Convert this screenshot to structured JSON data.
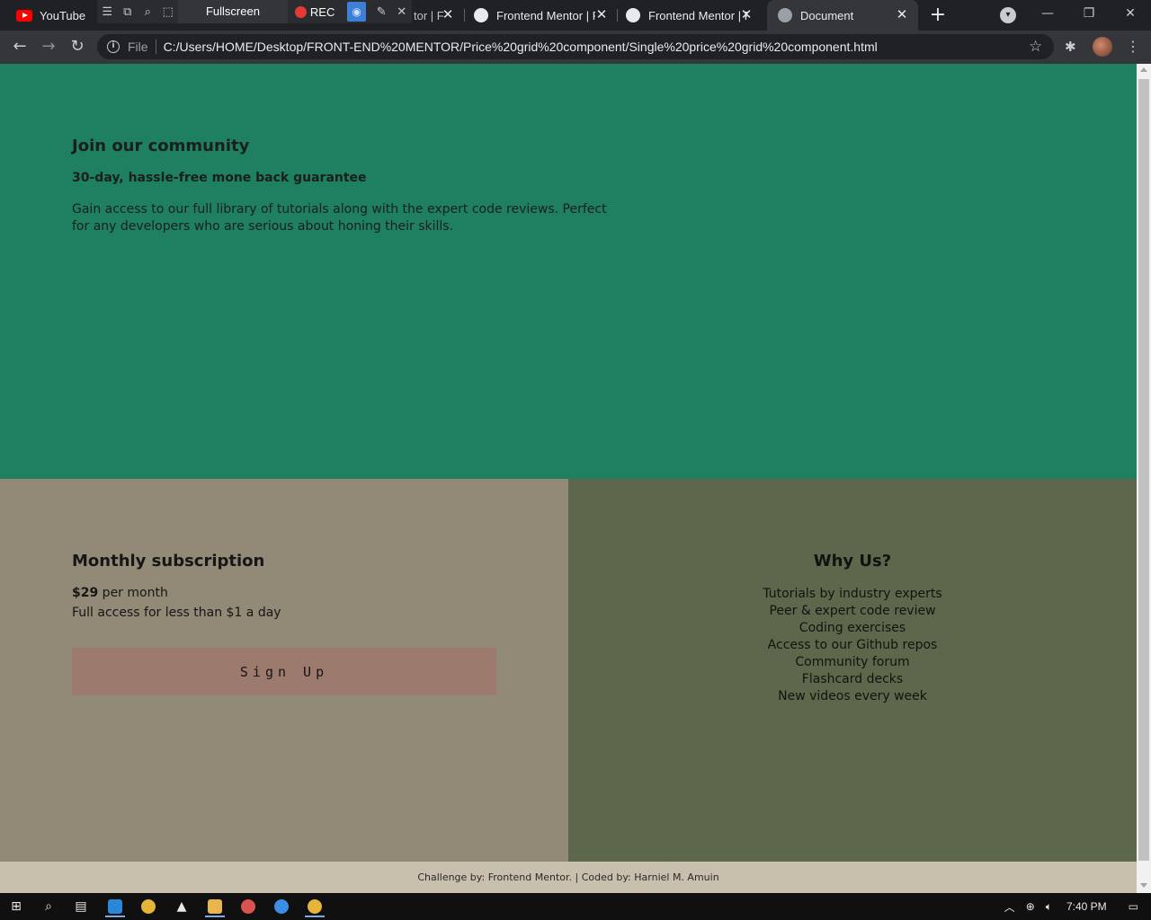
{
  "browser": {
    "tabs": [
      {
        "title": "YouTube"
      },
      {
        "title": "tor | F"
      },
      {
        "title": "Frontend Mentor | F"
      },
      {
        "title": "Frontend Mentor | F"
      },
      {
        "title": "Document"
      }
    ],
    "recorder": {
      "fullscreen_label": "Fullscreen",
      "rec_label": "REC"
    },
    "address": {
      "scheme_label": "File",
      "url": "C:/Users/HOME/Desktop/FRONT-END%20MENTOR/Price%20grid%20component/Single%20price%20grid%20component.html"
    }
  },
  "page": {
    "community": {
      "title": "Join our community",
      "subtitle": "30-day, hassle-free mone back guarantee",
      "description": "Gain access to our full library of tutorials along with the expert code reviews. Perfect for any developers who are serious about honing their skills."
    },
    "subscription": {
      "title": "Monthly subscription",
      "price": "$29",
      "period": " per month",
      "access": "Full access for less than $1 a day",
      "button": "Sign Up"
    },
    "why": {
      "title": "Why Us?",
      "items": [
        "Tutorials by industry experts",
        "Peer & expert code review",
        "Coding exercises",
        "Access to our Github repos",
        "Community forum",
        "Flashcard decks",
        "New videos every week"
      ]
    },
    "footer": "Challenge by: Frontend Mentor. | Coded by: Harniel M. Amuin"
  },
  "taskbar": {
    "clock": "7:40 PM"
  },
  "colors": {
    "top": "#1f7f61",
    "left": "#928a76",
    "right": "#5d674b",
    "button": "#9c7b6e",
    "footer": "#c8bfac"
  }
}
